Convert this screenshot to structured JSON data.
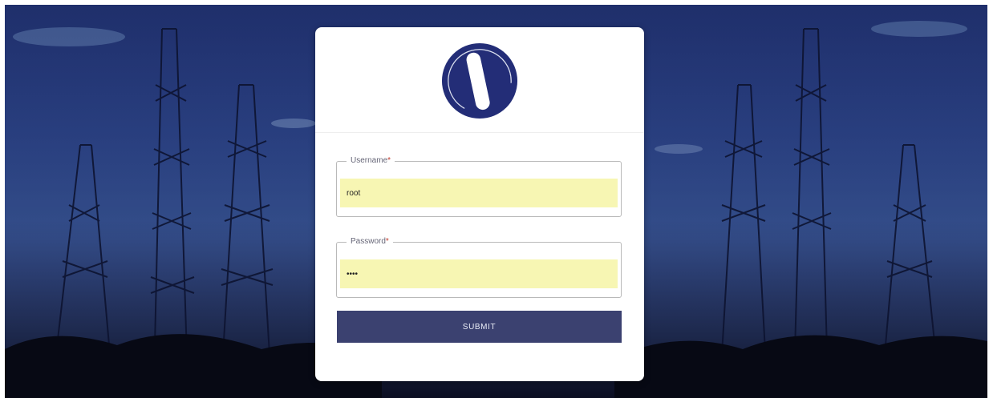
{
  "login_form": {
    "username_label": "Username",
    "username_value": "root",
    "password_label": "Password",
    "password_value": "••••",
    "required_mark": "*",
    "submit_label": "SUBMIT"
  },
  "icons": {
    "logo": "brand-logo",
    "background": "telecom-towers"
  },
  "colors": {
    "brand": "#232d77",
    "button": "#3b4170",
    "autofill": "#f7f6b3"
  }
}
